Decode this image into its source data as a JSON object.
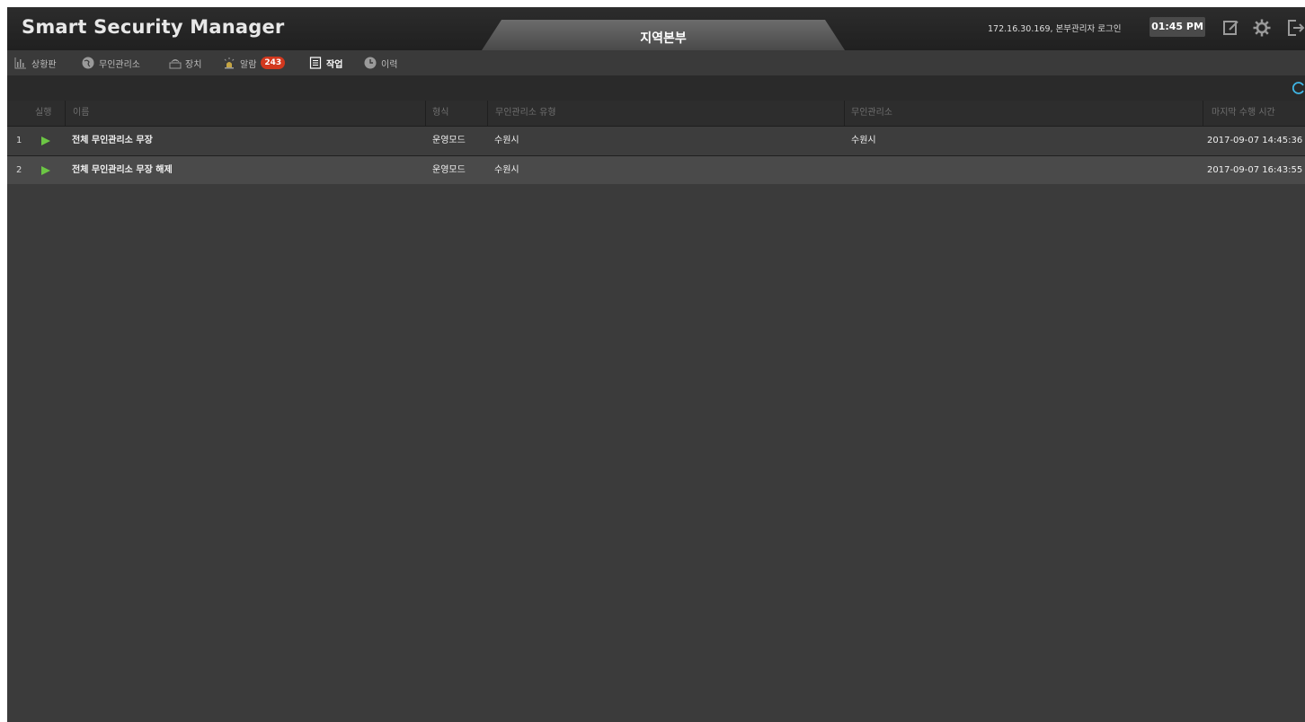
{
  "header": {
    "app_title": "Smart Security Manager",
    "center_tab": "지역본부",
    "login_info": "172.16.30.169, 본부관리자 로그인",
    "clock": "01:45 PM",
    "icons": [
      "edit-icon",
      "gear-icon",
      "logout-icon"
    ]
  },
  "nav": {
    "items": [
      {
        "label": "상황판",
        "icon": "bar-chart-icon"
      },
      {
        "label": "무인관리소",
        "icon": "globe-icon"
      },
      {
        "label": "장치",
        "icon": "device-icon"
      },
      {
        "label": "알람",
        "icon": "siren-icon",
        "badge": "243"
      },
      {
        "label": "작업",
        "icon": "document-icon",
        "active": true
      },
      {
        "label": "이력",
        "icon": "clock-icon"
      }
    ]
  },
  "table": {
    "columns": [
      "실행",
      "이름",
      "형식",
      "무인관리소 유형",
      "무인관리소",
      "마지막 수행 시간"
    ],
    "rows": [
      {
        "num": "1",
        "name": "전체 무인관리소 무장",
        "type": "운영모드",
        "site_type": "수원시",
        "site": "수원시",
        "last_run": "2017-09-07 14:45:36"
      },
      {
        "num": "2",
        "name": "전체 무인관리소 무장 해제",
        "type": "운영모드",
        "site_type": "수원시",
        "site": "",
        "last_run": "2017-09-07 16:43:55"
      }
    ]
  },
  "colors": {
    "background": "#3b3b3b",
    "header": "#222222",
    "play": "#6cc644",
    "badge": "#d2381e",
    "refresh": "#3fb6e6"
  }
}
